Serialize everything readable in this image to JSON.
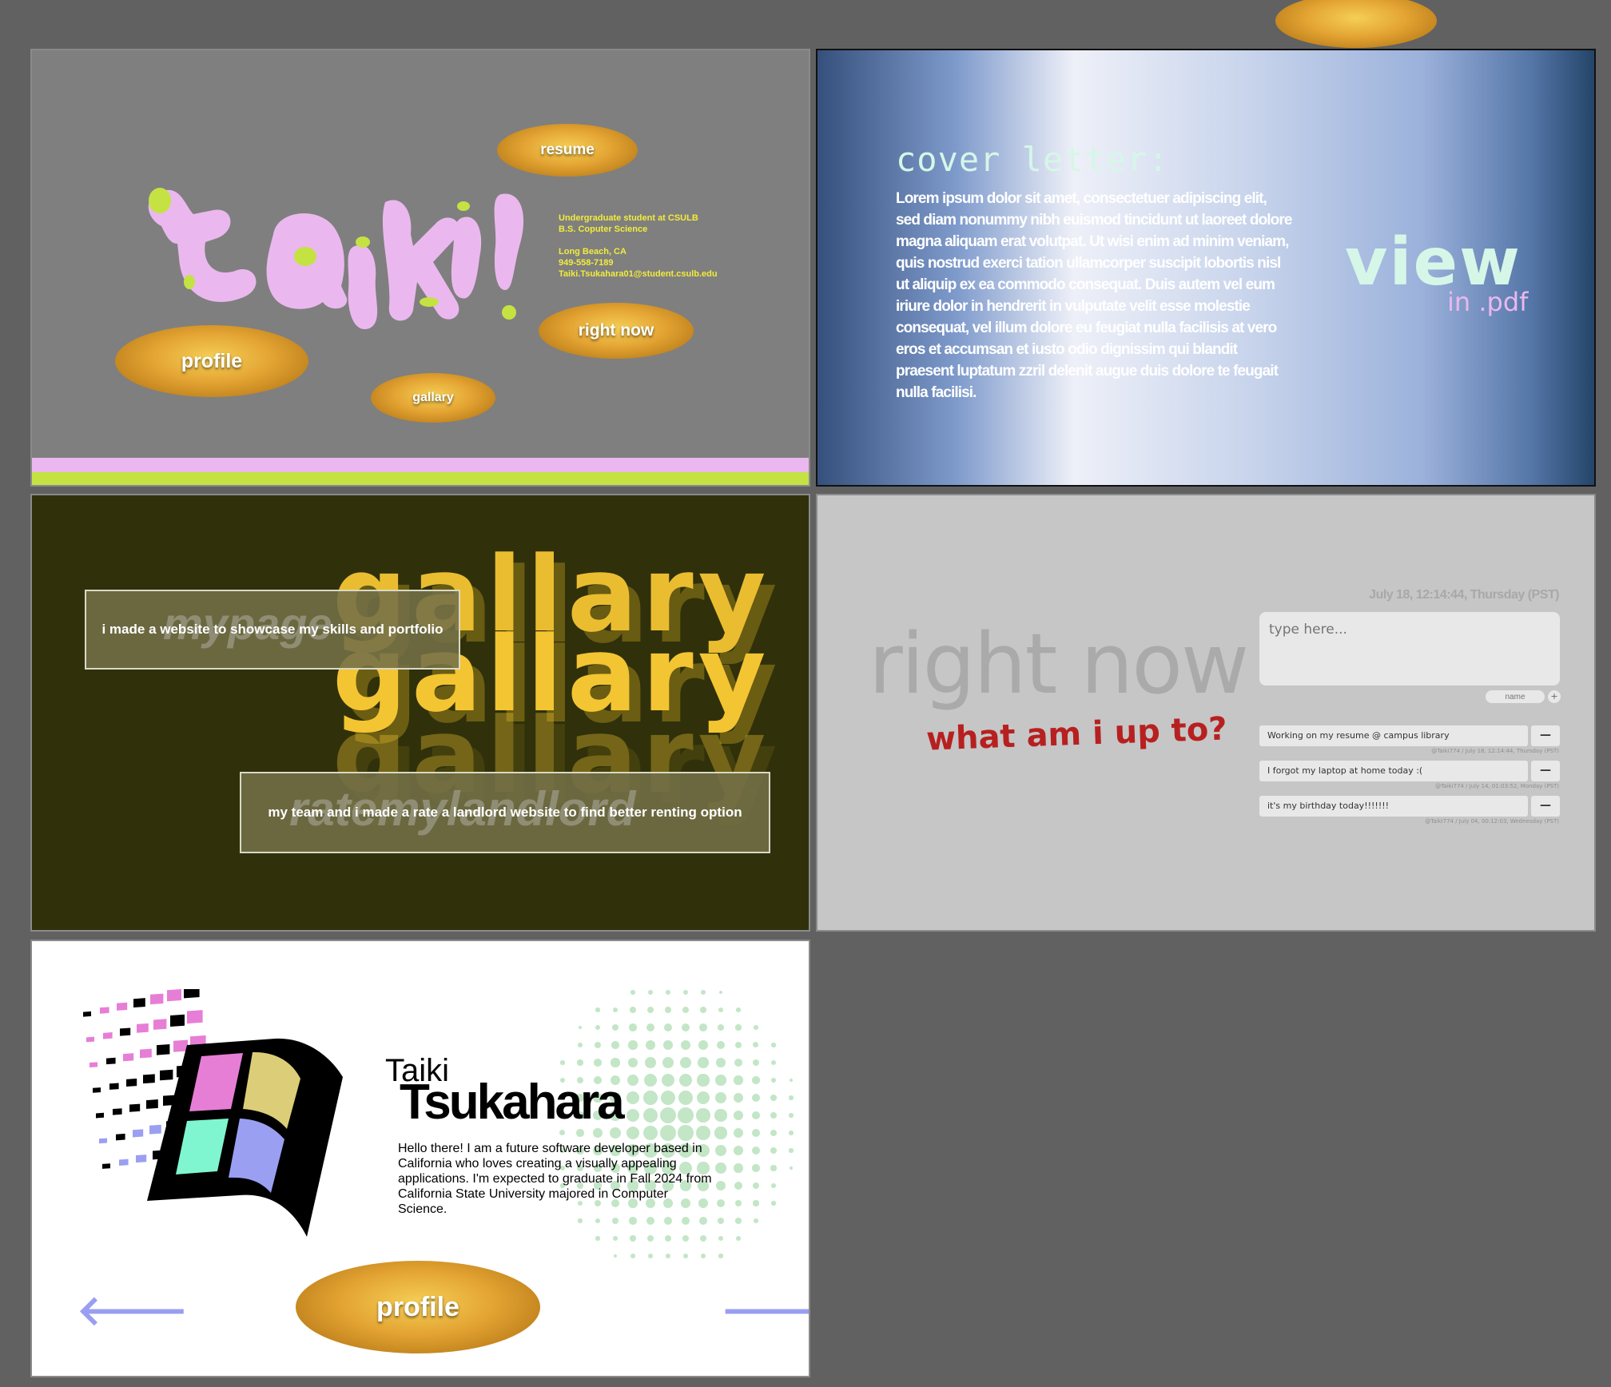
{
  "top_button": {
    "label": ""
  },
  "home": {
    "logo_text": "taiki",
    "info_lines": [
      "Undergraduate student at CSULB",
      "B.S. Coputer Science",
      "",
      "Long Beach, CA",
      "949-558-7189",
      "Taiki.Tsukahara01@student.csulb.edu"
    ],
    "nav": {
      "resume": "resume",
      "right_now": "right now",
      "profile": "profile",
      "gallary": "gallary"
    },
    "colors": {
      "pink": "#eab8ee",
      "lime": "#c5e243",
      "bg": "#7f7f7f"
    }
  },
  "cover": {
    "heading": "cover letter:",
    "body": "Lorem ipsum dolor sit amet, consectetuer adipiscing elit, sed diam nonummy nibh euismod tincidunt ut laoreet dolore magna aliquam erat volutpat. Ut wisi enim ad minim veniam, quis nostrud exerci tation ullamcorper suscipit lobortis nisl ut aliquip ex ea commodo consequat. Duis autem vel eum iriure dolor in hendrerit in vulputate velit esse molestie consequat, vel illum dolore eu feugiat nulla facilisis at vero eros et accumsan et iusto odio dignissim qui blandit praesent luptatum zzril delenit augue duis dolore te feugait nulla facilisi.",
    "view": "view",
    "in_pdf": "in .pdf"
  },
  "gallery": {
    "word": "gallary",
    "project1": {
      "ghost": "mypage",
      "caption": "i made a website to showcase my skills and portfolio"
    },
    "project2": {
      "ghost": "ratemylandlord",
      "caption": "my team and i made a rate a landlord website to find better renting option"
    }
  },
  "rightnow": {
    "timestamp": "July 18, 12:14:44, Thursday (PST)",
    "title": "right now",
    "subtitle": "what am i up to?",
    "input_placeholder": "type here...",
    "name_placeholder": "name",
    "add_label": "+",
    "delete_label": "—",
    "posts": [
      {
        "text": "Working on my resume @ campus library",
        "meta": "@Taiki774  /  July 18, 12:14:44, Thursday (PST)"
      },
      {
        "text": "I forgot my laptop at home today :(",
        "meta": "@Taiki774  /  July 14, 01:03:52, Monday (PST)"
      },
      {
        "text": "it's my birthday today!!!!!!!",
        "meta": "@Taiki774  /  July 04, 00:12:03, Wednesday (PST)"
      }
    ]
  },
  "profile": {
    "first_name": "Taiki",
    "last_name": "Tsukahara",
    "bio": "Hello there! I am a future software developer based in California who loves creating a visually appealing applications. I'm expected to graduate in Fall 2024 from California State University majored in Computer Science.",
    "button": "profile",
    "prev": "🡐",
    "next": "🡒",
    "colors": {
      "pink": "#e77ed6",
      "yellow": "#dccd78",
      "mint": "#7ff6cf",
      "lavender": "#9b9ff2"
    }
  }
}
